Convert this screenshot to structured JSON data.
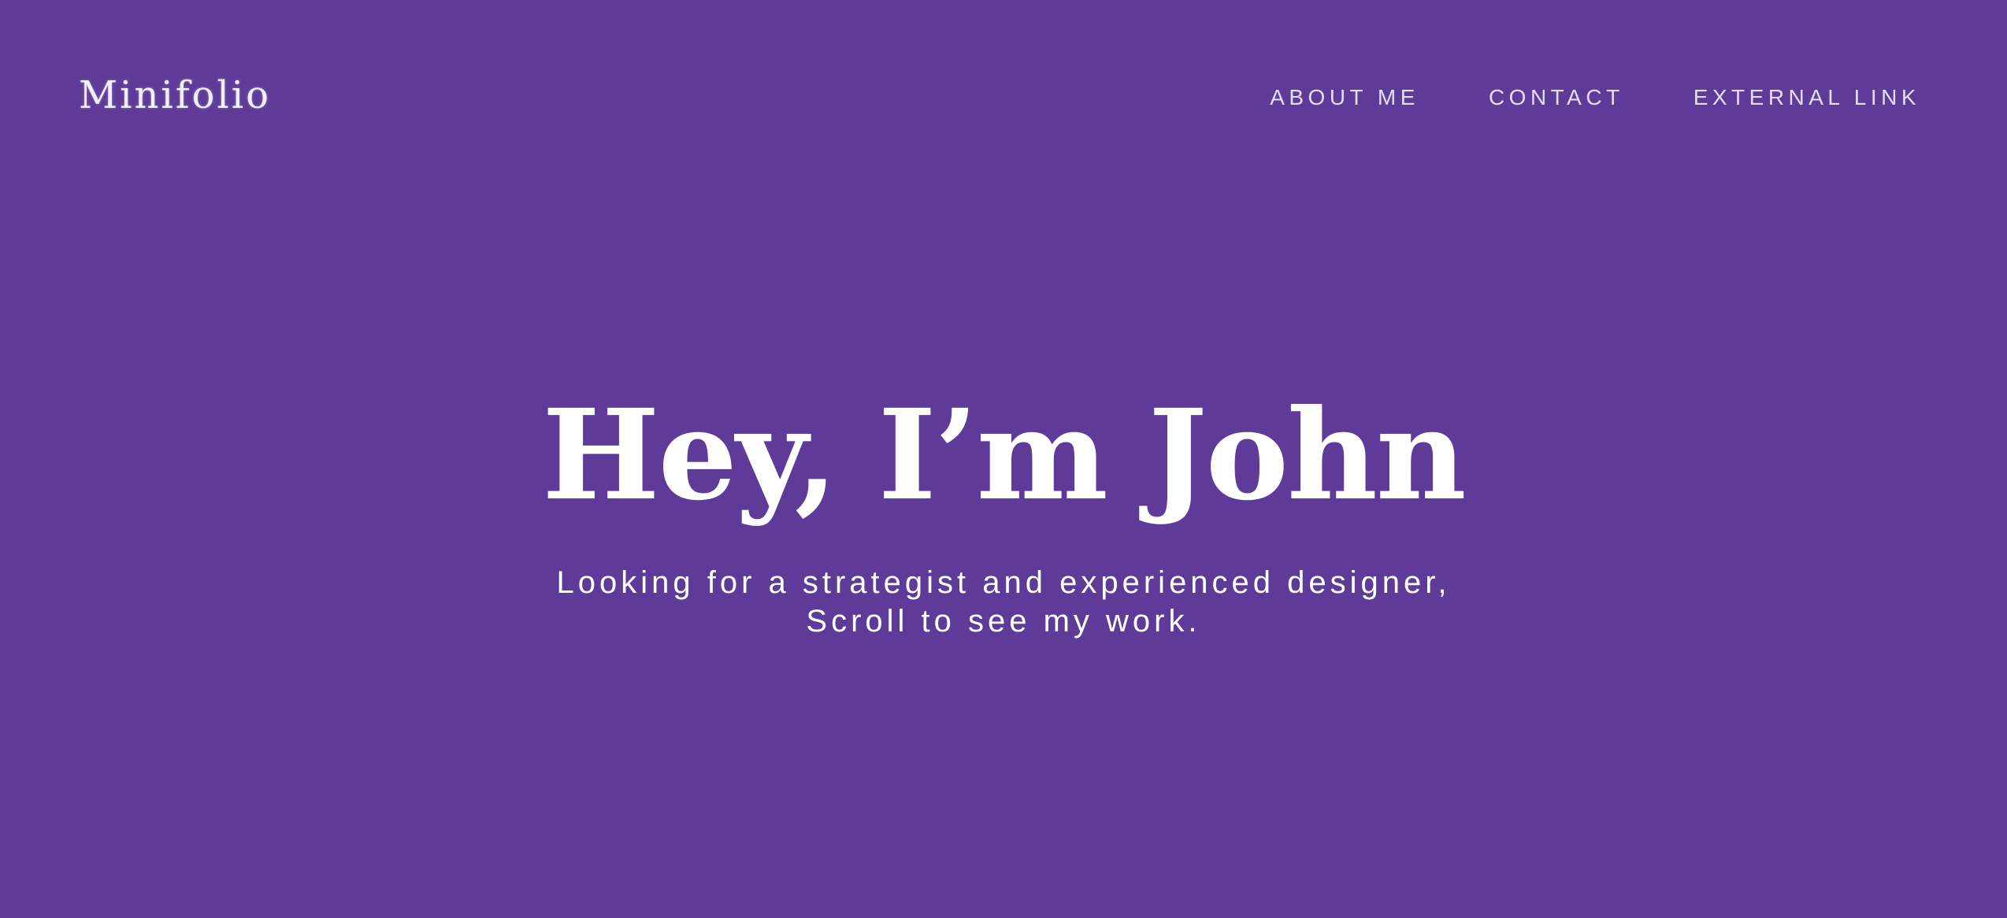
{
  "colors": {
    "background": "#5e3b98",
    "text": "#ffffff",
    "nav_text": "#e4dcf3"
  },
  "header": {
    "brand": "Minifolio",
    "nav": [
      {
        "label": "ABOUT ME"
      },
      {
        "label": "CONTACT"
      },
      {
        "label": "EXTERNAL LINK"
      }
    ]
  },
  "hero": {
    "title": "Hey, I’m John",
    "subtitle_line1": "Looking for a strategist and experienced designer,",
    "subtitle_line2": "Scroll to see my work."
  }
}
